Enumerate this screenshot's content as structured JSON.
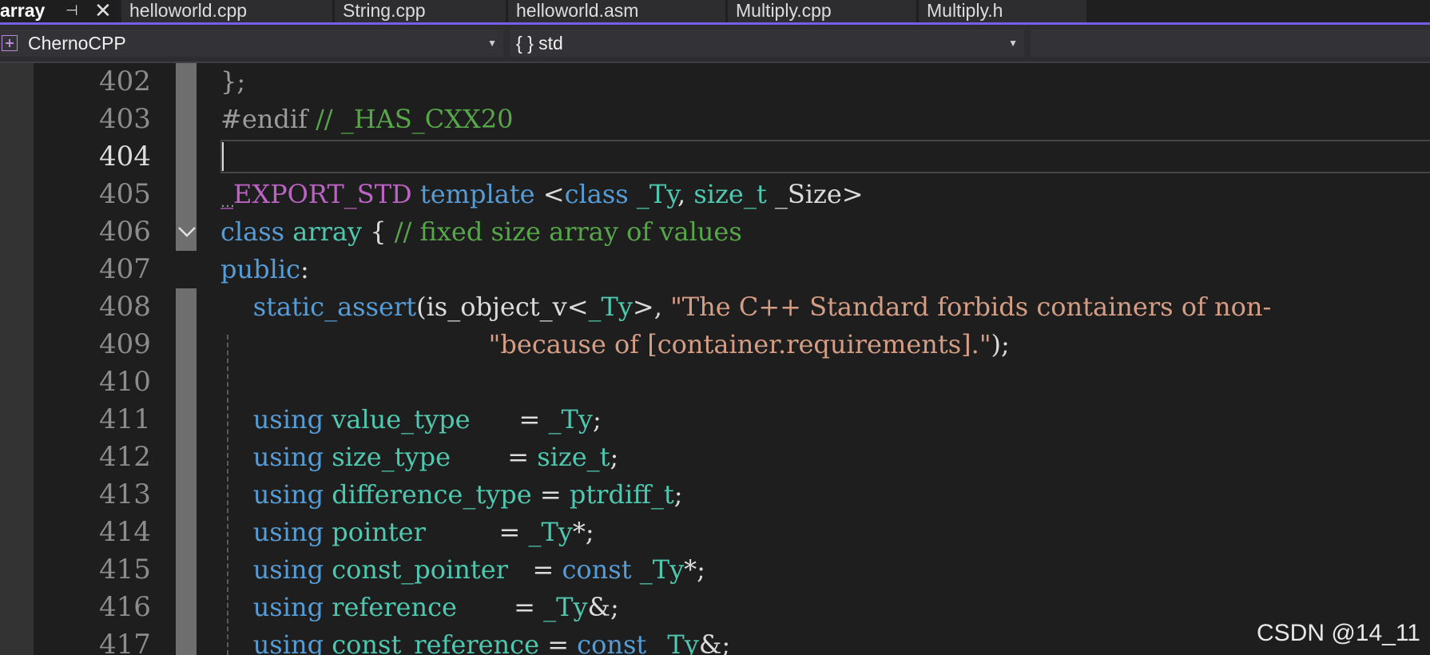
{
  "tabs": [
    {
      "label": "array",
      "active": true,
      "pin_icon": "pin-icon",
      "close_icon": "close-icon"
    },
    {
      "label": "helloworld.cpp"
    },
    {
      "label": "String.cpp"
    },
    {
      "label": "helloworld.asm"
    },
    {
      "label": "Multiply.cpp"
    },
    {
      "label": "Multiply.h"
    }
  ],
  "nav": {
    "project": "ChernoCPP",
    "scope": "{ } std"
  },
  "editor": {
    "current_line": "404",
    "lines": [
      {
        "no": "402",
        "tokens": [
          [
            "pp",
            "};"
          ]
        ]
      },
      {
        "no": "403",
        "tokens": [
          [
            "pp",
            "#endif "
          ],
          [
            "cm",
            "// _HAS_CXX20"
          ]
        ]
      },
      {
        "no": "404",
        "tokens": []
      },
      {
        "no": "405",
        "tokens": [
          [
            "mc",
            "_EXPORT_STD"
          ],
          [
            "pl",
            " "
          ],
          [
            "kw",
            "template"
          ],
          [
            "pl",
            " <"
          ],
          [
            "kw",
            "class"
          ],
          [
            "pl",
            " "
          ],
          [
            "ty",
            "_Ty"
          ],
          [
            "pl",
            ", "
          ],
          [
            "ty",
            "size_t"
          ],
          [
            "pl",
            " _Size>"
          ]
        ]
      },
      {
        "no": "406",
        "tokens": [
          [
            "kw",
            "class"
          ],
          [
            "pl",
            " "
          ],
          [
            "ty",
            "array"
          ],
          [
            "pl",
            " { "
          ],
          [
            "cm",
            "// fixed size array of values"
          ]
        ]
      },
      {
        "no": "407",
        "tokens": [
          [
            "kw",
            "public"
          ],
          [
            "pl",
            ":"
          ]
        ]
      },
      {
        "no": "408",
        "tokens": [
          [
            "pl",
            "    "
          ],
          [
            "kw",
            "static_assert"
          ],
          [
            "pl",
            "(is_object_v<"
          ],
          [
            "ty",
            "_Ty"
          ],
          [
            "pl",
            ">, "
          ],
          [
            "st",
            "\"The C++ Standard forbids containers of non-"
          ]
        ]
      },
      {
        "no": "409",
        "tokens": [
          [
            "pl",
            "                                 "
          ],
          [
            "st",
            "\"because of [container.requirements].\""
          ],
          [
            "pl",
            ");"
          ]
        ]
      },
      {
        "no": "410",
        "tokens": []
      },
      {
        "no": "411",
        "tokens": [
          [
            "pl",
            "    "
          ],
          [
            "kw",
            "using"
          ],
          [
            "pl",
            " "
          ],
          [
            "ty",
            "value_type"
          ],
          [
            "pl",
            "      = "
          ],
          [
            "ty",
            "_Ty"
          ],
          [
            "pl",
            ";"
          ]
        ]
      },
      {
        "no": "412",
        "tokens": [
          [
            "pl",
            "    "
          ],
          [
            "kw",
            "using"
          ],
          [
            "pl",
            " "
          ],
          [
            "ty",
            "size_type"
          ],
          [
            "pl",
            "       = "
          ],
          [
            "ty",
            "size_t"
          ],
          [
            "pl",
            ";"
          ]
        ]
      },
      {
        "no": "413",
        "tokens": [
          [
            "pl",
            "    "
          ],
          [
            "kw",
            "using"
          ],
          [
            "pl",
            " "
          ],
          [
            "ty",
            "difference_type"
          ],
          [
            "pl",
            " = "
          ],
          [
            "ty",
            "ptrdiff_t"
          ],
          [
            "pl",
            ";"
          ]
        ]
      },
      {
        "no": "414",
        "tokens": [
          [
            "pl",
            "    "
          ],
          [
            "kw",
            "using"
          ],
          [
            "pl",
            " "
          ],
          [
            "ty",
            "pointer"
          ],
          [
            "pl",
            "         = "
          ],
          [
            "ty",
            "_Ty"
          ],
          [
            "pl",
            "*;"
          ]
        ]
      },
      {
        "no": "415",
        "tokens": [
          [
            "pl",
            "    "
          ],
          [
            "kw",
            "using"
          ],
          [
            "pl",
            " "
          ],
          [
            "ty",
            "const_pointer"
          ],
          [
            "pl",
            "   = "
          ],
          [
            "kw",
            "const"
          ],
          [
            "pl",
            " "
          ],
          [
            "ty",
            "_Ty"
          ],
          [
            "pl",
            "*;"
          ]
        ]
      },
      {
        "no": "416",
        "tokens": [
          [
            "pl",
            "    "
          ],
          [
            "kw",
            "using"
          ],
          [
            "pl",
            " "
          ],
          [
            "ty",
            "reference"
          ],
          [
            "pl",
            "       = "
          ],
          [
            "ty",
            "_Ty"
          ],
          [
            "pl",
            "&;"
          ]
        ]
      },
      {
        "no": "417",
        "tokens": [
          [
            "pl",
            "    "
          ],
          [
            "kw",
            "using"
          ],
          [
            "pl",
            " "
          ],
          [
            "ty",
            "const_reference"
          ],
          [
            "pl",
            " = "
          ],
          [
            "kw",
            "const"
          ],
          [
            "pl",
            " "
          ],
          [
            "ty",
            "_Ty"
          ],
          [
            "pl",
            "&;"
          ]
        ]
      }
    ]
  },
  "watermark": "CSDN @14_11"
}
